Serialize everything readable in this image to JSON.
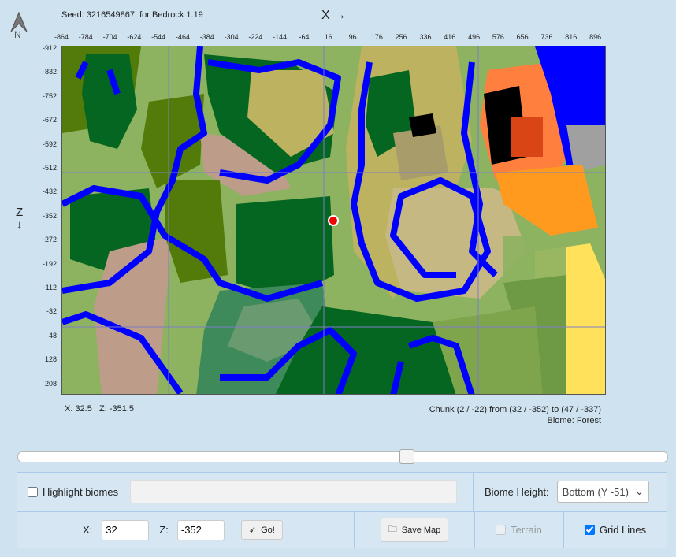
{
  "header": {
    "seed_text": "Seed: 3216549867, for Bedrock 1.19",
    "x_axis": "X →",
    "z_axis": "Z",
    "z_arrow": "↓",
    "compass": "N"
  },
  "x_ticks": [
    "-864",
    "-784",
    "-704",
    "-624",
    "-544",
    "-464",
    "-384",
    "-304",
    "-224",
    "-144",
    "-64",
    "16",
    "96",
    "176",
    "256",
    "336",
    "416",
    "496",
    "576",
    "656",
    "736",
    "816",
    "896"
  ],
  "z_ticks": [
    "-912",
    "-832",
    "-752",
    "-672",
    "-592",
    "-512",
    "-432",
    "-352",
    "-272",
    "-192",
    "-112",
    "-32",
    "48",
    "128",
    "208"
  ],
  "status": {
    "x_label": "X: 32.5",
    "z_label": "Z: -351.5",
    "chunk": "Chunk (2 / -22) from (32 / -352) to (47 / -337)",
    "biome": "Biome: Forest"
  },
  "slider": {
    "value": 0.6
  },
  "controls": {
    "highlight_label": "Highlight biomes",
    "highlight_checked": false,
    "biome_height_label": "Biome Height:",
    "biome_height_value": "Bottom (Y -51)",
    "x_label": "X:",
    "x_value": "32",
    "z_label": "Z:",
    "z_value": "-352",
    "go_label": "Go!",
    "save_label": "Save Map",
    "terrain_label": "Terrain",
    "gridlines_label": "Grid Lines"
  },
  "colors": {
    "plains": "#8db360",
    "forest": "#056621",
    "dark": "#537b09",
    "savanna": "#bdb25f",
    "river": "#0000ff",
    "mesa": "#d94515"
  }
}
